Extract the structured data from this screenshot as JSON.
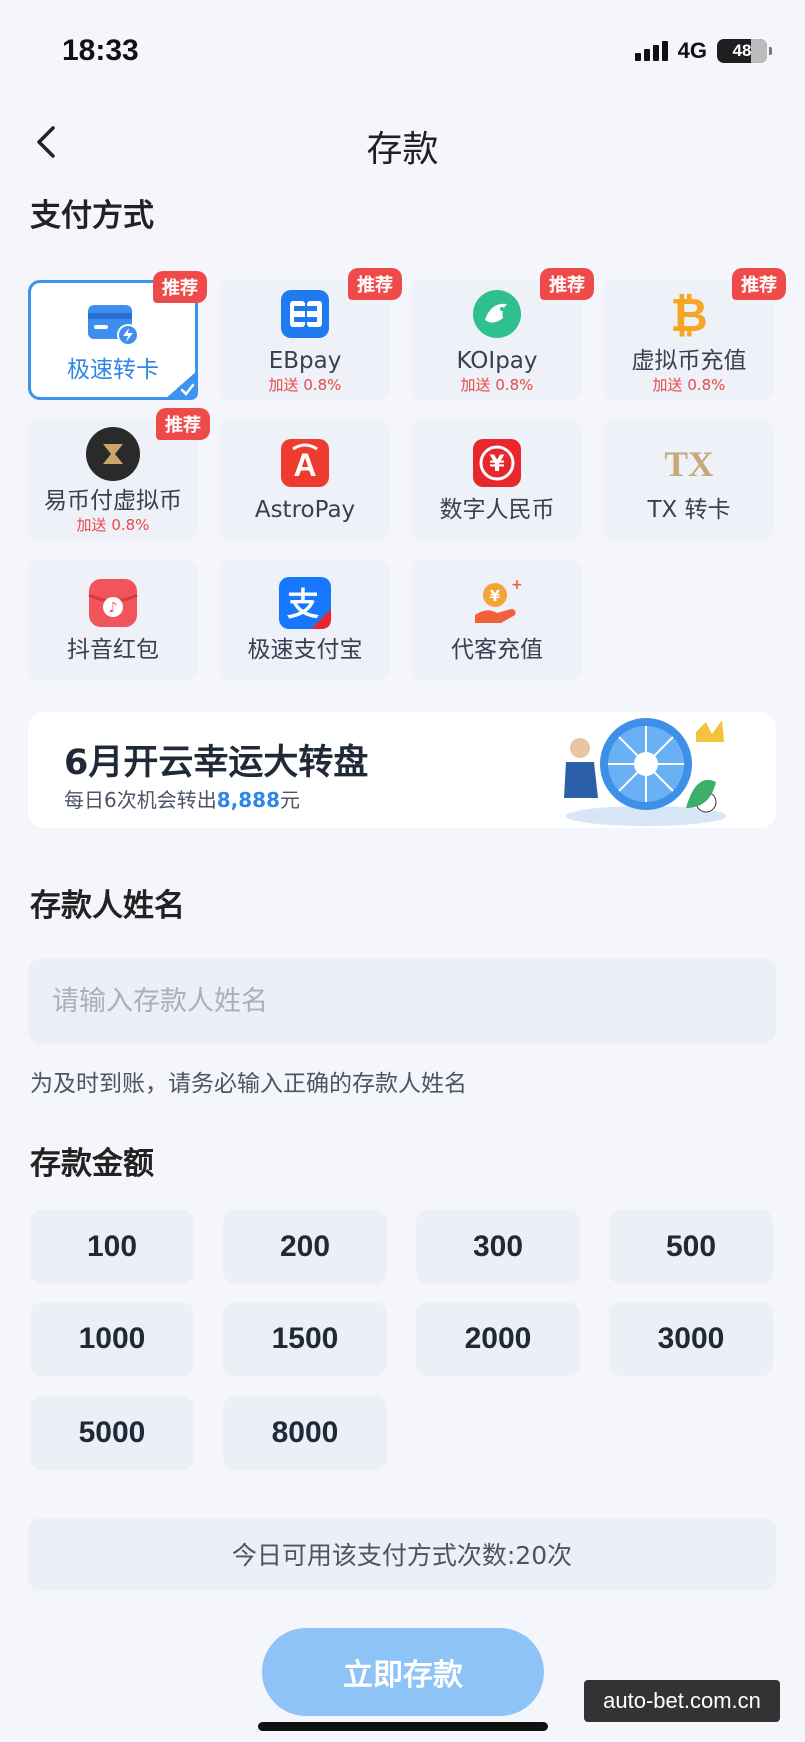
{
  "status_bar": {
    "time": "18:33",
    "network": "4G",
    "battery": "48"
  },
  "nav": {
    "title": "存款"
  },
  "payment": {
    "section_title": "支付方式",
    "methods": [
      {
        "label": "极速转卡",
        "bonus": "",
        "badge": "推荐",
        "selected": true,
        "icon": "card-flash-icon"
      },
      {
        "label": "EBpay",
        "bonus": "加送 0.8%",
        "badge": "推荐",
        "icon": "ebpay-icon"
      },
      {
        "label": "KOIpay",
        "bonus": "加送 0.8%",
        "badge": "推荐",
        "icon": "koi-icon"
      },
      {
        "label": "虚拟币充值",
        "bonus": "加送 0.8%",
        "badge": "推荐",
        "icon": "bitcoin-icon"
      },
      {
        "label": "易币付虚拟币",
        "bonus": "加送 0.8%",
        "badge": "推荐",
        "icon": "ebifu-icon"
      },
      {
        "label": "AstroPay",
        "bonus": "",
        "badge": "",
        "icon": "astropay-icon"
      },
      {
        "label": "数字人民币",
        "bonus": "",
        "badge": "",
        "icon": "digital-rmb-icon"
      },
      {
        "label": "TX 转卡",
        "bonus": "",
        "badge": "",
        "icon": "tx-icon"
      },
      {
        "label": "抖音红包",
        "bonus": "",
        "badge": "",
        "icon": "douyin-redpacket-icon"
      },
      {
        "label": "极速支付宝",
        "bonus": "",
        "badge": "",
        "icon": "alipay-icon"
      },
      {
        "label": "代客充值",
        "bonus": "",
        "badge": "",
        "icon": "agent-recharge-icon"
      }
    ]
  },
  "banner": {
    "title": "6月开云幸运大转盘",
    "sub_prefix": "每日6次机会转出",
    "sub_amount": "8,888",
    "sub_suffix": "元"
  },
  "depositor": {
    "section_title": "存款人姓名",
    "placeholder": "请输入存款人姓名",
    "value": "",
    "hint": "为及时到账，请务必输入正确的存款人姓名"
  },
  "amount": {
    "section_title": "存款金额",
    "options": [
      "100",
      "200",
      "300",
      "500",
      "1000",
      "1500",
      "2000",
      "3000",
      "5000",
      "8000"
    ]
  },
  "limit_text": "今日可用该支付方式次数:20次",
  "submit_label": "立即存款",
  "watermark": "auto-bet.com.cn",
  "colors": {
    "accent": "#3b94ee",
    "badge": "#ef4a4a",
    "bonus": "#e84a4a",
    "submit": "#8ec3f7"
  }
}
